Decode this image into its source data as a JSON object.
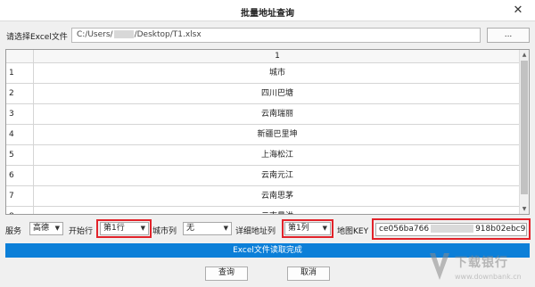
{
  "window": {
    "title": "批量地址查询",
    "close_glyph": "✕"
  },
  "file": {
    "label": "请选择Excel文件",
    "path_prefix": "C:/Users/",
    "path_suffix": "/Desktop/T1.xlsx",
    "browse_label": "..."
  },
  "grid": {
    "column_header": "1",
    "rows": [
      {
        "num": "1",
        "value": "城市"
      },
      {
        "num": "2",
        "value": "四川巴塘"
      },
      {
        "num": "3",
        "value": "云南瑞丽"
      },
      {
        "num": "4",
        "value": "新疆巴里坤"
      },
      {
        "num": "5",
        "value": "上海松江"
      },
      {
        "num": "6",
        "value": "云南元江"
      },
      {
        "num": "7",
        "value": "云南思茅"
      },
      {
        "num": "8",
        "value": "云南景洪"
      }
    ]
  },
  "controls": {
    "service_label": "服务",
    "service_value": "高德",
    "start_row_label": "开始行",
    "start_row_value": "第1行",
    "city_col_label": "城市列",
    "city_col_value": "无",
    "detail_col_label": "详细地址列",
    "detail_col_value": "第1列",
    "key_label": "地图KEY",
    "key_prefix": "ce056ba766",
    "key_suffix": "918b02ebc9"
  },
  "status": {
    "text": "Excel文件读取完成"
  },
  "buttons": {
    "query": "查询",
    "cancel": "取消"
  },
  "watermark": {
    "brand": "下载银行",
    "url": "www.downbank.cn"
  },
  "colors": {
    "status_bar": "#0c7fd8",
    "highlight": "#e2232a"
  }
}
